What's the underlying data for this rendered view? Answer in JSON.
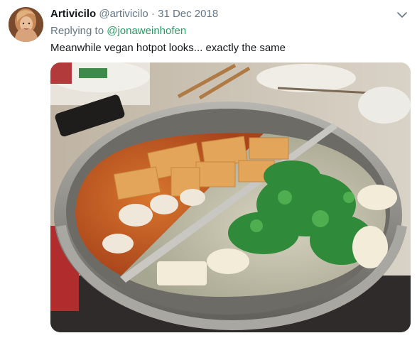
{
  "tweet": {
    "display_name": "Artivicilo",
    "handle": "@artivicilo",
    "separator": "·",
    "date": "31 Dec 2018",
    "reply_prefix": "Replying to",
    "reply_mention": "@jonaweinhofen",
    "text": "Meanwhile vegan hotpot looks... exactly the same"
  },
  "icons": {
    "menu": "chevron-down-icon",
    "avatar": "profile-photo"
  },
  "colors": {
    "name": "#14171a",
    "secondary": "#657786",
    "mention": "#2b9b64",
    "background": "#ffffff"
  }
}
